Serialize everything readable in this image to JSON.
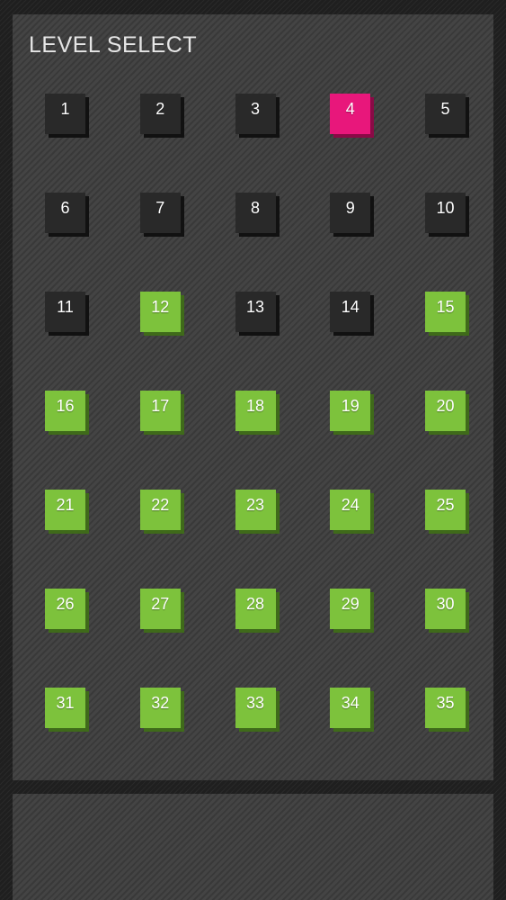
{
  "title": "LEVEL SELECT",
  "colors": {
    "locked": "#292929",
    "current": "#e8177b",
    "completed": "#7dc23c",
    "panel": "#444444"
  },
  "levels": [
    {
      "label": "1",
      "status": "locked"
    },
    {
      "label": "2",
      "status": "locked"
    },
    {
      "label": "3",
      "status": "locked"
    },
    {
      "label": "4",
      "status": "current"
    },
    {
      "label": "5",
      "status": "locked"
    },
    {
      "label": "6",
      "status": "locked"
    },
    {
      "label": "7",
      "status": "locked"
    },
    {
      "label": "8",
      "status": "locked"
    },
    {
      "label": "9",
      "status": "locked"
    },
    {
      "label": "10",
      "status": "locked"
    },
    {
      "label": "11",
      "status": "locked"
    },
    {
      "label": "12",
      "status": "completed"
    },
    {
      "label": "13",
      "status": "locked"
    },
    {
      "label": "14",
      "status": "locked"
    },
    {
      "label": "15",
      "status": "completed"
    },
    {
      "label": "16",
      "status": "completed"
    },
    {
      "label": "17",
      "status": "completed"
    },
    {
      "label": "18",
      "status": "completed"
    },
    {
      "label": "19",
      "status": "completed"
    },
    {
      "label": "20",
      "status": "completed"
    },
    {
      "label": "21",
      "status": "completed"
    },
    {
      "label": "22",
      "status": "completed"
    },
    {
      "label": "23",
      "status": "completed"
    },
    {
      "label": "24",
      "status": "completed"
    },
    {
      "label": "25",
      "status": "completed"
    },
    {
      "label": "26",
      "status": "completed"
    },
    {
      "label": "27",
      "status": "completed"
    },
    {
      "label": "28",
      "status": "completed"
    },
    {
      "label": "29",
      "status": "completed"
    },
    {
      "label": "30",
      "status": "completed"
    },
    {
      "label": "31",
      "status": "completed"
    },
    {
      "label": "32",
      "status": "completed"
    },
    {
      "label": "33",
      "status": "completed"
    },
    {
      "label": "34",
      "status": "completed"
    },
    {
      "label": "35",
      "status": "completed"
    }
  ]
}
